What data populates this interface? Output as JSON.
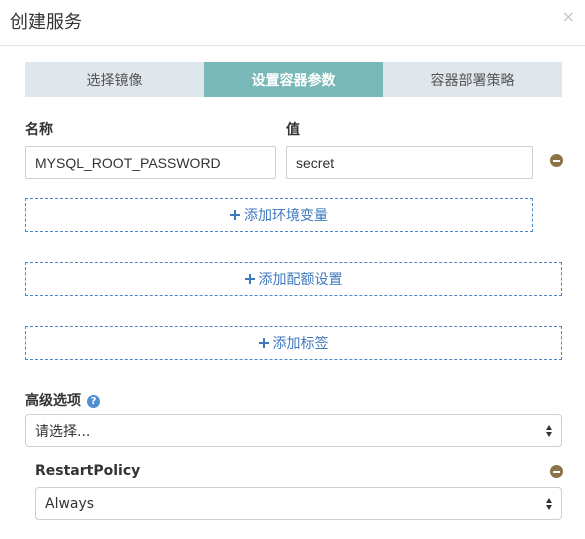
{
  "dialog": {
    "title": "创建服务",
    "close_glyph": "×"
  },
  "steps": [
    {
      "label": "选择镜像",
      "active": false
    },
    {
      "label": "设置容器参数",
      "active": true
    },
    {
      "label": "容器部署策略",
      "active": false
    }
  ],
  "env": {
    "name_label": "名称",
    "value_label": "值",
    "rows": [
      {
        "name": "MYSQL_ROOT_PASSWORD",
        "value": "secret"
      }
    ],
    "add_env_label": "添加环境变量",
    "add_quota_label": "添加配额设置",
    "add_tag_label": "添加标签"
  },
  "advanced": {
    "label": "高级选项",
    "help_glyph": "?",
    "select_value": "请选择...",
    "restart_policy": {
      "label": "RestartPolicy",
      "value": "Always"
    }
  },
  "colors": {
    "active_step": "#78b9b8",
    "inactive_step": "#dfe6ec",
    "link_blue": "#3e78bd",
    "remove_icon": "#8b7346"
  }
}
